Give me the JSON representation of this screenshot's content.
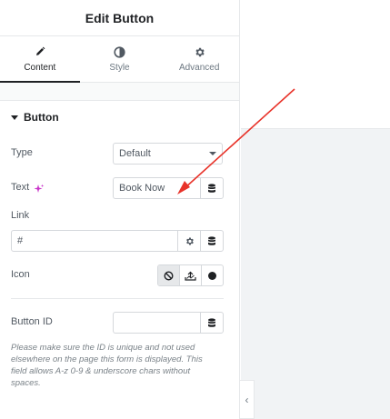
{
  "header": {
    "title": "Edit Button"
  },
  "tabs": [
    {
      "label": "Content",
      "icon": "pencil-icon",
      "active": true
    },
    {
      "label": "Style",
      "icon": "half-circle-icon",
      "active": false
    },
    {
      "label": "Advanced",
      "icon": "gear-icon",
      "active": false
    }
  ],
  "section": {
    "title": "Button",
    "expanded": true
  },
  "fields": {
    "type": {
      "label": "Type",
      "value": "Default"
    },
    "text": {
      "label": "Text",
      "value": "Book Now",
      "ai_icon": "sparkle-icon"
    },
    "link": {
      "label": "Link",
      "value": "#"
    },
    "icon": {
      "label": "Icon",
      "options": [
        "none-icon",
        "upload-icon",
        "circle-icon"
      ],
      "selected": "none-icon"
    },
    "button_id": {
      "label": "Button ID",
      "value": ""
    }
  },
  "help_text": "Please make sure the ID is unique and not used elsewhere on the page this form is displayed. This field allows A-z  0-9 & underscore chars without spaces.",
  "colors": {
    "accent": "#1f2124",
    "annotation_arrow": "#e8332a",
    "ai_sparkle": "#c935c9"
  },
  "collapse_handle": {
    "icon": "chevron-left-icon",
    "glyph": "‹"
  }
}
